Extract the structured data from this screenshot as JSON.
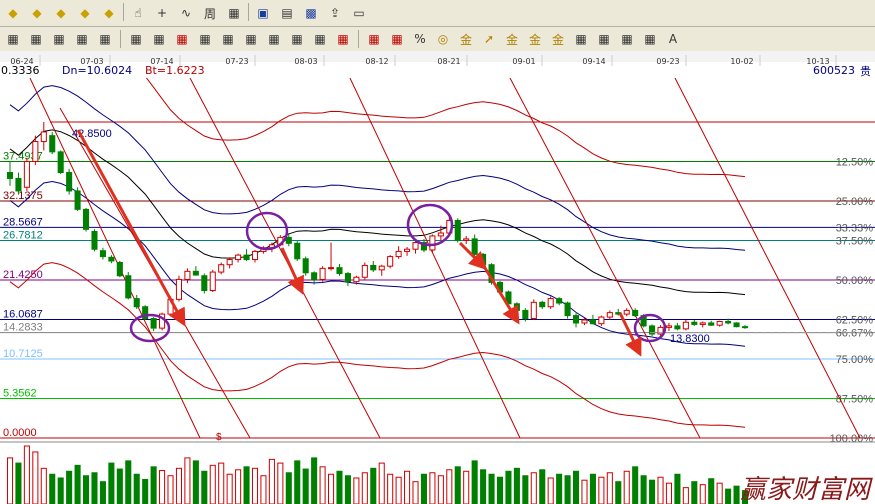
{
  "toolbar_row1": {
    "buttons": [
      {
        "icon": "zoom-in-diamond-icon"
      },
      {
        "icon": "zoom-out-diamond-icon"
      },
      {
        "icon": "move-left-diamond-icon"
      },
      {
        "icon": "move-right-diamond-icon"
      },
      {
        "icon": "crosshair-diamond-icon"
      },
      {
        "icon": "hand-cursor-icon"
      },
      {
        "icon": "crosshair-icon"
      },
      {
        "icon": "draw-tool-icon"
      },
      {
        "icon": "period-icon"
      },
      {
        "icon": "scale-icon"
      },
      {
        "icon": "calendar-icon"
      },
      {
        "icon": "data-window-icon"
      },
      {
        "icon": "save-icon"
      },
      {
        "icon": "export-icon"
      },
      {
        "icon": "print-icon"
      }
    ]
  },
  "toolbar_row2": {
    "groups": [
      [
        "line-tool-icon",
        "cross-line-icon",
        "bar-tool-icon",
        "kline-tool-icon",
        "box-tool-icon"
      ],
      [
        "vert-line-icon",
        "ray-tool-icon",
        "channel-icon",
        "parallel-line-icon",
        "fan-line-icon",
        "wave-icon",
        "grid-tool-icon",
        "grid-lines-icon",
        "time-grid-icon",
        "fib-fan-icon"
      ],
      [
        "parallel-channel-icon",
        "fib-retrace-icon",
        "percent-icon",
        "gold-circle-icon",
        "gold-ratio-icon",
        "gold-arrow-icon",
        "gold-channel-icon",
        "gold-line-icon",
        "gold-level-icon",
        "cycle-tool-icon",
        "cycle-lines-icon",
        "gann-tool-icon",
        "gann-fan-icon",
        "text-note-icon"
      ]
    ]
  },
  "date_axis": [
    "06-24",
    "07-03",
    "07-14",
    "07-23",
    "08-03",
    "08-12",
    "08-21",
    "09-01",
    "09-14",
    "09-23",
    "10-02",
    "10-13"
  ],
  "info_bar": {
    "first_value": "0.3336",
    "dn": "Dn=10.6024",
    "bt": "Bt=1.6223",
    "stock_code": "600523",
    "stock_suffix": "贵"
  },
  "watermark": "赢家财富网",
  "chart_data": {
    "type": "candlestick",
    "title": "",
    "price_levels_left": [
      {
        "label": "37.4937",
        "value": 37.4937
      },
      {
        "label": "32.1375",
        "value": 32.1375
      },
      {
        "label": "28.5667",
        "value": 28.5667
      },
      {
        "label": "26.7812",
        "value": 26.7812
      },
      {
        "label": "21.4250",
        "value": 21.425
      },
      {
        "label": "16.0687",
        "value": 16.0687
      },
      {
        "label": "14.2833",
        "value": 14.2833
      },
      {
        "label": "10.7125",
        "value": 10.7125
      },
      {
        "label": "5.3562",
        "value": 5.3562
      },
      {
        "label": "0.0000",
        "value": 0
      }
    ],
    "percent_levels_right": [
      "12.50%",
      "25.00%",
      "33.33%",
      "37.50%",
      "50.00%",
      "62.50%",
      "66.67%",
      "75.00%",
      "87.50%",
      "100.00%"
    ],
    "annotations": {
      "high_label": "42.8500",
      "low_label": "13.8300",
      "dividend_mark": "$"
    },
    "ohlc": [
      [
        36.0,
        37.5,
        34.2,
        35.2
      ],
      [
        35.2,
        36.0,
        33.0,
        33.5
      ],
      [
        34.0,
        38.0,
        33.5,
        37.5
      ],
      [
        37.5,
        41.0,
        37.0,
        40.2
      ],
      [
        40.2,
        42.85,
        39.0,
        41.5
      ],
      [
        41.0,
        41.5,
        38.5,
        38.8
      ],
      [
        38.8,
        39.0,
        35.8,
        36.0
      ],
      [
        36.0,
        36.5,
        33.0,
        33.5
      ],
      [
        33.5,
        34.0,
        30.8,
        31.0
      ],
      [
        31.0,
        31.2,
        28.0,
        28.3
      ],
      [
        28.0,
        28.3,
        25.3,
        25.6
      ],
      [
        25.4,
        25.8,
        24.2,
        24.6
      ],
      [
        24.5,
        24.8,
        23.7,
        24.0
      ],
      [
        23.8,
        24.0,
        21.8,
        22.0
      ],
      [
        22.0,
        22.5,
        18.8,
        19.0
      ],
      [
        18.9,
        19.4,
        17.5,
        17.8
      ],
      [
        17.8,
        18.0,
        16.0,
        16.2
      ],
      [
        16.2,
        16.4,
        14.5,
        14.9
      ],
      [
        14.9,
        17.0,
        14.6,
        16.8
      ],
      [
        16.8,
        19.2,
        16.5,
        18.8
      ],
      [
        18.8,
        22.0,
        18.5,
        21.5
      ],
      [
        21.5,
        23.0,
        21.0,
        22.6
      ],
      [
        22.6,
        23.3,
        22.0,
        22.1
      ],
      [
        22.0,
        22.3,
        19.6,
        20.0
      ],
      [
        20.0,
        22.8,
        19.8,
        22.5
      ],
      [
        22.5,
        23.8,
        22.2,
        23.5
      ],
      [
        23.5,
        24.5,
        23.0,
        24.2
      ],
      [
        24.2,
        25.0,
        23.8,
        24.8
      ],
      [
        24.8,
        25.6,
        24.0,
        24.2
      ],
      [
        24.2,
        25.5,
        23.8,
        25.3
      ],
      [
        25.3,
        26.0,
        25.0,
        25.8
      ],
      [
        25.8,
        26.5,
        25.2,
        26.2
      ],
      [
        26.2,
        27.5,
        26.0,
        27.2
      ],
      [
        27.2,
        27.8,
        26.0,
        26.4
      ],
      [
        26.4,
        26.7,
        24.0,
        24.3
      ],
      [
        24.3,
        24.6,
        22.0,
        22.4
      ],
      [
        22.4,
        22.6,
        20.8,
        21.5
      ],
      [
        21.5,
        23.3,
        21.2,
        23.0
      ],
      [
        23.0,
        26.5,
        22.7,
        23.1
      ],
      [
        23.1,
        23.6,
        22.0,
        22.3
      ],
      [
        22.3,
        22.5,
        20.6,
        21.2
      ],
      [
        21.2,
        22.0,
        20.8,
        21.8
      ],
      [
        21.8,
        23.8,
        21.5,
        23.4
      ],
      [
        23.4,
        24.0,
        22.5,
        22.8
      ],
      [
        22.8,
        23.5,
        22.0,
        23.3
      ],
      [
        23.3,
        24.8,
        23.0,
        24.6
      ],
      [
        24.6,
        26.0,
        24.3,
        25.3
      ],
      [
        25.3,
        25.9,
        24.7,
        25.6
      ],
      [
        25.6,
        26.8,
        25.0,
        26.5
      ],
      [
        26.5,
        27.0,
        25.2,
        25.5
      ],
      [
        25.5,
        27.6,
        25.2,
        27.4
      ],
      [
        27.4,
        28.8,
        26.8,
        27.8
      ],
      [
        27.8,
        30.0,
        27.5,
        29.5
      ],
      [
        29.5,
        29.8,
        26.5,
        26.8
      ],
      [
        26.8,
        27.4,
        26.3,
        27.0
      ],
      [
        27.0,
        27.6,
        24.5,
        24.9
      ],
      [
        24.9,
        25.1,
        23.2,
        23.5
      ],
      [
        23.5,
        23.7,
        20.8,
        21.1
      ],
      [
        21.1,
        21.3,
        19.5,
        19.8
      ],
      [
        19.8,
        20.0,
        17.8,
        18.2
      ],
      [
        18.2,
        18.4,
        17.0,
        17.3
      ],
      [
        17.3,
        17.6,
        15.8,
        16.2
      ],
      [
        16.2,
        18.8,
        16.0,
        18.4
      ],
      [
        18.4,
        18.6,
        17.5,
        17.8
      ],
      [
        17.8,
        19.2,
        17.5,
        18.9
      ],
      [
        18.9,
        19.1,
        18.0,
        18.3
      ],
      [
        18.3,
        18.5,
        16.2,
        16.6
      ],
      [
        16.6,
        16.9,
        15.0,
        15.6
      ],
      [
        15.6,
        16.3,
        15.3,
        16.0
      ],
      [
        16.0,
        16.7,
        15.4,
        15.5
      ],
      [
        15.5,
        16.6,
        15.2,
        16.4
      ],
      [
        16.4,
        17.3,
        16.0,
        17.0
      ],
      [
        17.0,
        17.5,
        16.6,
        16.8
      ],
      [
        16.8,
        17.6,
        16.5,
        17.3
      ],
      [
        17.3,
        17.6,
        16.4,
        16.6
      ],
      [
        16.6,
        16.8,
        15.0,
        15.2
      ],
      [
        15.2,
        15.4,
        13.83,
        14.1
      ],
      [
        14.1,
        15.3,
        13.9,
        15.0
      ],
      [
        15.0,
        15.6,
        14.5,
        15.2
      ],
      [
        15.2,
        15.6,
        14.6,
        14.8
      ],
      [
        14.8,
        16.0,
        14.6,
        15.7
      ],
      [
        15.7,
        16.0,
        15.2,
        15.4
      ],
      [
        15.4,
        15.8,
        15.0,
        15.6
      ],
      [
        15.6,
        15.9,
        15.2,
        15.3
      ],
      [
        15.3,
        15.9,
        15.1,
        15.8
      ],
      [
        15.8,
        16.2,
        15.4,
        15.6
      ],
      [
        15.6,
        15.7,
        15.0,
        15.1
      ],
      [
        15.1,
        15.3,
        14.8,
        15.0
      ]
    ],
    "volume": [
      62,
      55,
      78,
      70,
      48,
      40,
      35,
      44,
      52,
      38,
      42,
      30,
      55,
      47,
      58,
      40,
      33,
      50,
      45,
      38,
      48,
      62,
      58,
      44,
      52,
      55,
      40,
      46,
      50,
      48,
      38,
      60,
      55,
      42,
      58,
      47,
      62,
      50,
      40,
      44,
      38,
      35,
      42,
      48,
      55,
      40,
      36,
      44,
      30,
      40,
      42,
      38,
      46,
      50,
      44,
      58,
      46,
      40,
      36,
      44,
      48,
      38,
      42,
      46,
      35,
      40,
      38,
      44,
      32,
      40,
      36,
      42,
      30,
      44,
      50,
      38,
      32,
      36,
      28,
      40,
      22,
      30,
      26,
      34,
      28,
      20,
      24,
      18
    ],
    "volume_colors": [
      "r",
      "g",
      "r",
      "r",
      "r",
      "g",
      "g",
      "g",
      "g",
      "g",
      "g",
      "g",
      "g",
      "g",
      "g",
      "g",
      "g",
      "g",
      "r",
      "r",
      "r",
      "r",
      "g",
      "g",
      "r",
      "r",
      "r",
      "r",
      "g",
      "r",
      "r",
      "r",
      "r",
      "g",
      "g",
      "g",
      "g",
      "r",
      "r",
      "g",
      "g",
      "r",
      "r",
      "g",
      "r",
      "r",
      "r",
      "r",
      "r",
      "g",
      "r",
      "r",
      "r",
      "g",
      "r",
      "g",
      "g",
      "g",
      "g",
      "g",
      "g",
      "g",
      "r",
      "g",
      "r",
      "g",
      "g",
      "g",
      "r",
      "g",
      "r",
      "r",
      "g",
      "r",
      "g",
      "g",
      "g",
      "r",
      "r",
      "g",
      "r",
      "g",
      "r",
      "g",
      "r",
      "g",
      "g",
      "g"
    ]
  }
}
